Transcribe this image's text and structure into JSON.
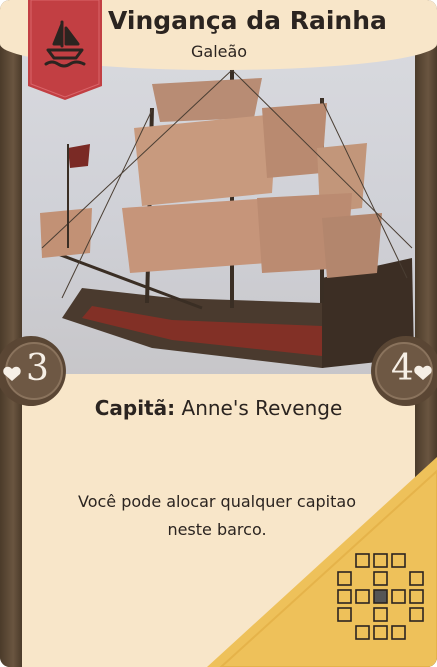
{
  "card": {
    "title": "Vingança da Rainha",
    "subtitle": "Galeão",
    "captain_label": "Capitã:",
    "captain_name": "Anne's Revenge",
    "description": "Você pode alocar qualquer capitao neste barco.",
    "stat_left": "3",
    "stat_right": "4",
    "ship_type_icon": "sailboat-icon",
    "stat_left_icon": "heart-icon",
    "stat_right_icon": "heart-icon"
  },
  "colors": {
    "frame": "#5b4a37",
    "parchment": "#f8e6c9",
    "ribbon": "#c23f43",
    "corner": "#eec15a",
    "medal": "#5a4634",
    "text": "#2b2420"
  },
  "range_grid": {
    "rows": [
      [
        0,
        0,
        1,
        1,
        1,
        0,
        0
      ],
      [
        0,
        1,
        0,
        1,
        0,
        1,
        0
      ],
      [
        0,
        1,
        1,
        2,
        1,
        1,
        0
      ],
      [
        0,
        1,
        0,
        1,
        0,
        1,
        0
      ],
      [
        0,
        0,
        1,
        1,
        1,
        0,
        0
      ]
    ]
  }
}
